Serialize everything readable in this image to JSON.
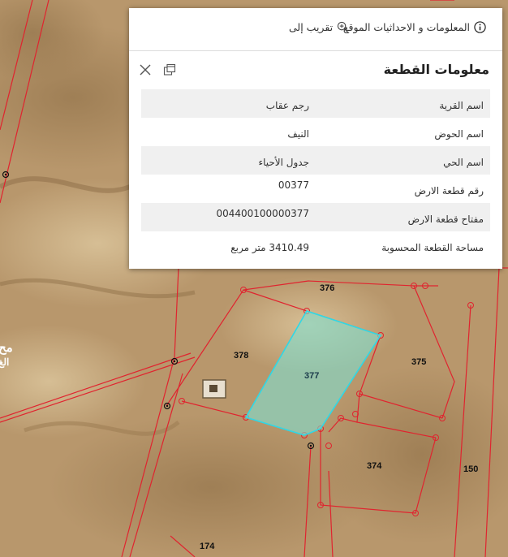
{
  "map": {
    "parcels": [
      {
        "id": "376",
        "label": "376"
      },
      {
        "id": "378",
        "label": "378"
      },
      {
        "id": "377",
        "label": "377",
        "selected": true
      },
      {
        "id": "375",
        "label": "375"
      },
      {
        "id": "374",
        "label": "374"
      },
      {
        "id": "150",
        "label": "150"
      },
      {
        "id": "174",
        "label": "174"
      }
    ],
    "edge_label_top": "مح",
    "edge_label_bottom": "الغ",
    "colors": {
      "boundary": "#e0242f",
      "selection_fill": "#7fe0d0",
      "selection_stroke": "#2fd8e6"
    }
  },
  "popup": {
    "actions": {
      "zoom_to": "تقريب إلى",
      "info_coords": "المعلومات و الاحداثيات الموقع"
    },
    "title": "معلومات القطعة",
    "rows": [
      {
        "key": "اسم القرية",
        "value": "رجم عقاب"
      },
      {
        "key": "اسم الحوض",
        "value": "النيف"
      },
      {
        "key": "اسم الحي",
        "value": "جدول الأحياء"
      },
      {
        "key": "رقم قطعة الارض",
        "value": "00377"
      },
      {
        "key": "مفتاح قطعة الارض",
        "value": "004400100000377"
      },
      {
        "key": "مساحة القطعة المحسوبة",
        "value": "3410.49 متر مربع"
      }
    ]
  }
}
